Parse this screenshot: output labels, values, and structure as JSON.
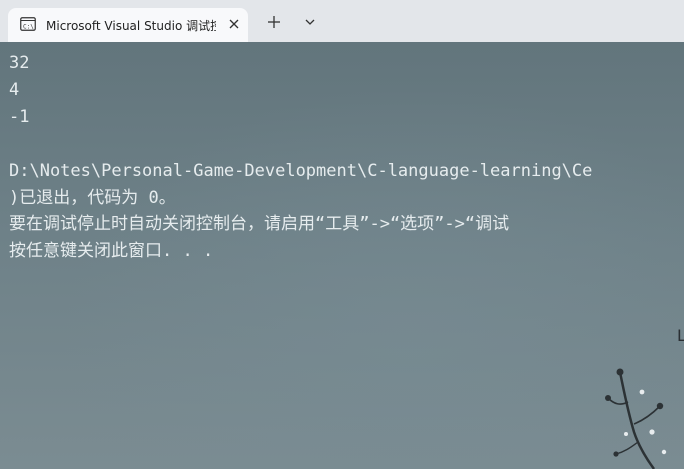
{
  "window": {
    "tab_title": "Microsoft Visual Studio 调试控"
  },
  "icons": {
    "tab_icon": "console-window-icon",
    "close": "close-icon",
    "new_tab": "plus-icon",
    "dropdown": "chevron-down-icon"
  },
  "console": {
    "lines": [
      "32",
      "4",
      "-1",
      "",
      "D:\\Notes\\Personal-Game-Development\\C-language-learning\\Ce",
      ")已退出，代码为 0。",
      "要在调试停止时自动关闭控制台，请启用“工具”->“选项”->“调试",
      "按任意键关闭此窗口. . ."
    ],
    "right_edge_glyph": "L"
  },
  "colors": {
    "titlebar": "#e3e6ea",
    "tab_active": "#f8f9fb",
    "console_bg": "#6b7d84",
    "console_text": "#e6ecee"
  }
}
